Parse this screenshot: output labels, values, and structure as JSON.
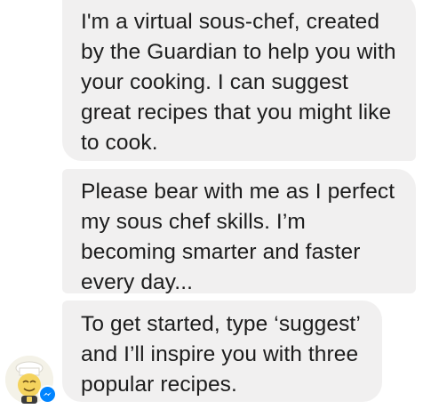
{
  "messages": [
    {
      "text": "I'm a virtual sous-chef, created by the Guardian to help you with your cooking. I can suggest great recipes that you might like to cook."
    },
    {
      "text": "Please bear with me as I perfect my sous chef skills. I’m becoming smarter and faster every day..."
    },
    {
      "text": "To get started, type ‘suggest’ and I’ll inspire you with three popular recipes."
    }
  ],
  "colors": {
    "bubble_background": "#f1f0f0",
    "text": "#1d1d1d",
    "messenger_blue": "#0084ff"
  },
  "icons": {
    "avatar": "chef-bot-avatar",
    "badge": "messenger-icon"
  }
}
